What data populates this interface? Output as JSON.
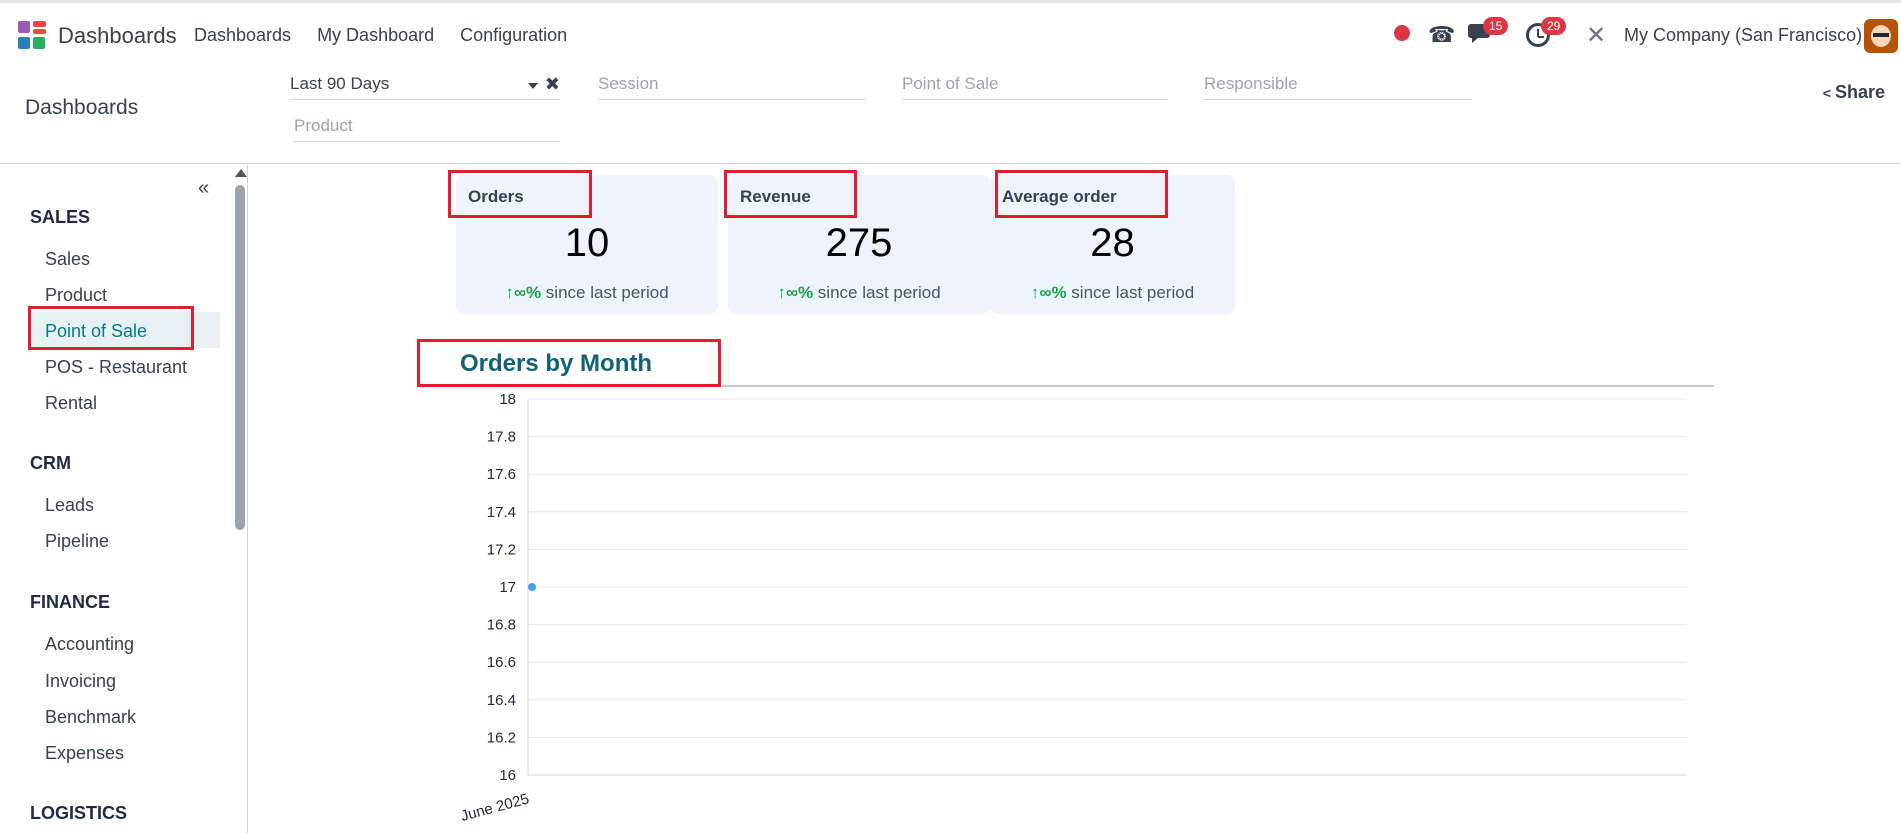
{
  "navbar": {
    "app_name": "Dashboards",
    "menu": [
      "Dashboards",
      "My Dashboard",
      "Configuration"
    ],
    "chat_count": "15",
    "activity_count": "29",
    "company": "My Company (San Francisco)"
  },
  "control": {
    "breadcrumb": "Dashboards",
    "filters": {
      "date_value": "Last 90 Days",
      "session_placeholder": "Session",
      "pos_placeholder": "Point of Sale",
      "responsible_placeholder": "Responsible",
      "product_placeholder": "Product"
    },
    "share_label": "Share"
  },
  "sidebar": {
    "collapse_glyph": "«",
    "sections": [
      {
        "title": "SALES",
        "items": [
          "Sales",
          "Product",
          "Point of Sale",
          "POS - Restaurant",
          "Rental"
        ]
      },
      {
        "title": "CRM",
        "items": [
          "Leads",
          "Pipeline"
        ]
      },
      {
        "title": "FINANCE",
        "items": [
          "Accounting",
          "Invoicing",
          "Benchmark",
          "Expenses"
        ]
      },
      {
        "title": "LOGISTICS",
        "items": []
      }
    ],
    "active_item": "Point of Sale"
  },
  "kpis": [
    {
      "label": "Orders",
      "value": "10",
      "trend_symbol": "↑∞%",
      "trend_text": " since last period"
    },
    {
      "label": "Revenue",
      "value": "275",
      "trend_symbol": "↑∞%",
      "trend_text": " since last period"
    },
    {
      "label": "Average order",
      "value": "28",
      "trend_symbol": "↑∞%",
      "trend_text": " since last period"
    }
  ],
  "colors": {
    "accent": "#017e84",
    "chart_title": "#0f6374",
    "highlight": "#e11d2e",
    "trend_up": "#16a34a",
    "point": "#4aa3df"
  },
  "chart_data": {
    "type": "line",
    "title": "Orders by Month",
    "xlabel": "",
    "ylabel": "",
    "x": [
      "June 2025"
    ],
    "series": [
      {
        "values": [
          17
        ]
      }
    ],
    "ylim": [
      16,
      18
    ],
    "yticks": [
      18,
      17.8,
      17.6,
      17.4,
      17.2,
      17,
      16.8,
      16.6,
      16.4,
      16.2,
      16
    ],
    "grid": true
  }
}
